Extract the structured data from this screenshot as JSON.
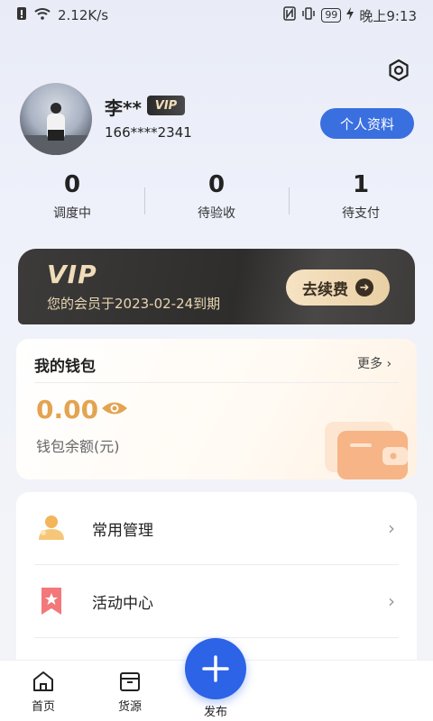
{
  "status_bar": {
    "network_speed": "2.12K/s",
    "battery": "99",
    "time": "晚上9:13"
  },
  "user": {
    "name": "李**",
    "badge": "VIP",
    "phone": "166****2341",
    "profile_button": "个人资料"
  },
  "stats": [
    {
      "value": "0",
      "label": "调度中"
    },
    {
      "value": "0",
      "label": "待验收"
    },
    {
      "value": "1",
      "label": "待支付"
    }
  ],
  "vip_card": {
    "logo": "VIP",
    "expire_text": "您的会员于2023-02-24到期",
    "renew_button": "去续费"
  },
  "wallet": {
    "title": "我的钱包",
    "more": "更多",
    "balance": "0.00",
    "balance_label": "钱包余额(元)"
  },
  "menu": [
    {
      "label": "常用管理",
      "icon": "user-group-icon"
    },
    {
      "label": "活动中心",
      "icon": "star-bookmark-icon"
    }
  ],
  "bottom_nav": {
    "home": "首页",
    "cargo": "货源",
    "publish": "发布"
  },
  "colors": {
    "accent_blue": "#3a6fe0",
    "wallet_orange": "#e3a451",
    "vip_gold": "#f0dcb8"
  }
}
